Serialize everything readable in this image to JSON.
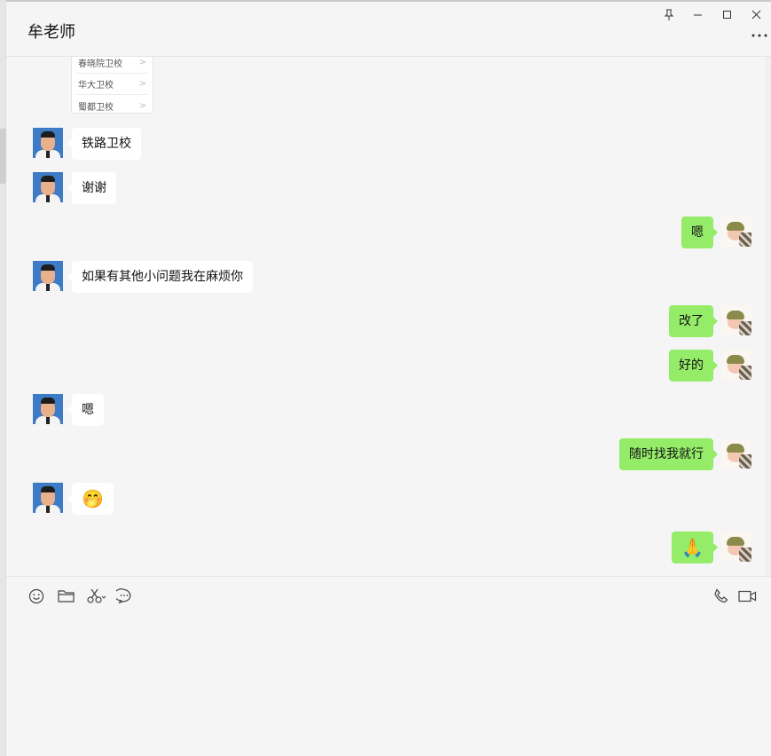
{
  "window": {
    "title": "牟老师",
    "controls": {
      "pin": "pin-icon",
      "minimize": "minimize-icon",
      "maximize": "maximize-icon",
      "close": "close-icon",
      "more": "more-icon"
    }
  },
  "school_card": {
    "rows": [
      {
        "label": "春晓院卫校"
      },
      {
        "label": "华大卫校"
      },
      {
        "label": "蜀都卫校"
      }
    ]
  },
  "messages": [
    {
      "sender": "teacher",
      "text": "铁路卫校"
    },
    {
      "sender": "teacher",
      "text": "谢谢"
    },
    {
      "sender": "me",
      "text": "嗯"
    },
    {
      "sender": "teacher",
      "text": "如果有其他小问题我在麻烦你"
    },
    {
      "sender": "me",
      "text": "改了"
    },
    {
      "sender": "me",
      "text": "好的"
    },
    {
      "sender": "teacher",
      "text": "嗯"
    },
    {
      "sender": "me",
      "text": "随时找我就行"
    },
    {
      "sender": "teacher",
      "text": "🤭"
    },
    {
      "sender": "me",
      "text": "🙏"
    }
  ],
  "toolbar": {
    "left": [
      "emoji-icon",
      "folder-icon",
      "scissors-icon",
      "chat-history-icon"
    ],
    "right": [
      "phone-icon",
      "video-icon"
    ]
  },
  "colors": {
    "my_bubble": "#95ec69",
    "their_bubble": "#ffffff",
    "background": "#f5f5f5"
  }
}
